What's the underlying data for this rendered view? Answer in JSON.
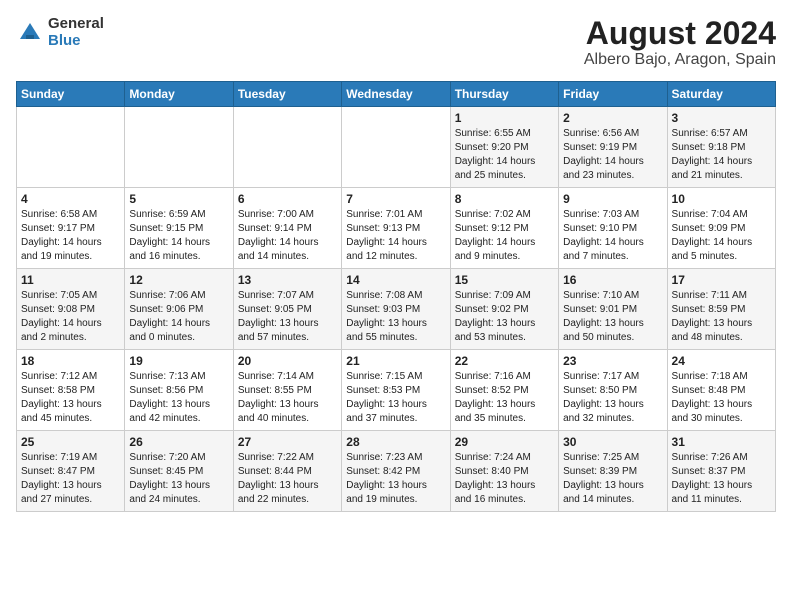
{
  "header": {
    "logo_general": "General",
    "logo_blue": "Blue",
    "month_title": "August 2024",
    "location": "Albero Bajo, Aragon, Spain"
  },
  "weekdays": [
    "Sunday",
    "Monday",
    "Tuesday",
    "Wednesday",
    "Thursday",
    "Friday",
    "Saturday"
  ],
  "weeks": [
    [
      {
        "day": "",
        "info": ""
      },
      {
        "day": "",
        "info": ""
      },
      {
        "day": "",
        "info": ""
      },
      {
        "day": "",
        "info": ""
      },
      {
        "day": "1",
        "info": "Sunrise: 6:55 AM\nSunset: 9:20 PM\nDaylight: 14 hours\nand 25 minutes."
      },
      {
        "day": "2",
        "info": "Sunrise: 6:56 AM\nSunset: 9:19 PM\nDaylight: 14 hours\nand 23 minutes."
      },
      {
        "day": "3",
        "info": "Sunrise: 6:57 AM\nSunset: 9:18 PM\nDaylight: 14 hours\nand 21 minutes."
      }
    ],
    [
      {
        "day": "4",
        "info": "Sunrise: 6:58 AM\nSunset: 9:17 PM\nDaylight: 14 hours\nand 19 minutes."
      },
      {
        "day": "5",
        "info": "Sunrise: 6:59 AM\nSunset: 9:15 PM\nDaylight: 14 hours\nand 16 minutes."
      },
      {
        "day": "6",
        "info": "Sunrise: 7:00 AM\nSunset: 9:14 PM\nDaylight: 14 hours\nand 14 minutes."
      },
      {
        "day": "7",
        "info": "Sunrise: 7:01 AM\nSunset: 9:13 PM\nDaylight: 14 hours\nand 12 minutes."
      },
      {
        "day": "8",
        "info": "Sunrise: 7:02 AM\nSunset: 9:12 PM\nDaylight: 14 hours\nand 9 minutes."
      },
      {
        "day": "9",
        "info": "Sunrise: 7:03 AM\nSunset: 9:10 PM\nDaylight: 14 hours\nand 7 minutes."
      },
      {
        "day": "10",
        "info": "Sunrise: 7:04 AM\nSunset: 9:09 PM\nDaylight: 14 hours\nand 5 minutes."
      }
    ],
    [
      {
        "day": "11",
        "info": "Sunrise: 7:05 AM\nSunset: 9:08 PM\nDaylight: 14 hours\nand 2 minutes."
      },
      {
        "day": "12",
        "info": "Sunrise: 7:06 AM\nSunset: 9:06 PM\nDaylight: 14 hours\nand 0 minutes."
      },
      {
        "day": "13",
        "info": "Sunrise: 7:07 AM\nSunset: 9:05 PM\nDaylight: 13 hours\nand 57 minutes."
      },
      {
        "day": "14",
        "info": "Sunrise: 7:08 AM\nSunset: 9:03 PM\nDaylight: 13 hours\nand 55 minutes."
      },
      {
        "day": "15",
        "info": "Sunrise: 7:09 AM\nSunset: 9:02 PM\nDaylight: 13 hours\nand 53 minutes."
      },
      {
        "day": "16",
        "info": "Sunrise: 7:10 AM\nSunset: 9:01 PM\nDaylight: 13 hours\nand 50 minutes."
      },
      {
        "day": "17",
        "info": "Sunrise: 7:11 AM\nSunset: 8:59 PM\nDaylight: 13 hours\nand 48 minutes."
      }
    ],
    [
      {
        "day": "18",
        "info": "Sunrise: 7:12 AM\nSunset: 8:58 PM\nDaylight: 13 hours\nand 45 minutes."
      },
      {
        "day": "19",
        "info": "Sunrise: 7:13 AM\nSunset: 8:56 PM\nDaylight: 13 hours\nand 42 minutes."
      },
      {
        "day": "20",
        "info": "Sunrise: 7:14 AM\nSunset: 8:55 PM\nDaylight: 13 hours\nand 40 minutes."
      },
      {
        "day": "21",
        "info": "Sunrise: 7:15 AM\nSunset: 8:53 PM\nDaylight: 13 hours\nand 37 minutes."
      },
      {
        "day": "22",
        "info": "Sunrise: 7:16 AM\nSunset: 8:52 PM\nDaylight: 13 hours\nand 35 minutes."
      },
      {
        "day": "23",
        "info": "Sunrise: 7:17 AM\nSunset: 8:50 PM\nDaylight: 13 hours\nand 32 minutes."
      },
      {
        "day": "24",
        "info": "Sunrise: 7:18 AM\nSunset: 8:48 PM\nDaylight: 13 hours\nand 30 minutes."
      }
    ],
    [
      {
        "day": "25",
        "info": "Sunrise: 7:19 AM\nSunset: 8:47 PM\nDaylight: 13 hours\nand 27 minutes."
      },
      {
        "day": "26",
        "info": "Sunrise: 7:20 AM\nSunset: 8:45 PM\nDaylight: 13 hours\nand 24 minutes."
      },
      {
        "day": "27",
        "info": "Sunrise: 7:22 AM\nSunset: 8:44 PM\nDaylight: 13 hours\nand 22 minutes."
      },
      {
        "day": "28",
        "info": "Sunrise: 7:23 AM\nSunset: 8:42 PM\nDaylight: 13 hours\nand 19 minutes."
      },
      {
        "day": "29",
        "info": "Sunrise: 7:24 AM\nSunset: 8:40 PM\nDaylight: 13 hours\nand 16 minutes."
      },
      {
        "day": "30",
        "info": "Sunrise: 7:25 AM\nSunset: 8:39 PM\nDaylight: 13 hours\nand 14 minutes."
      },
      {
        "day": "31",
        "info": "Sunrise: 7:26 AM\nSunset: 8:37 PM\nDaylight: 13 hours\nand 11 minutes."
      }
    ]
  ]
}
